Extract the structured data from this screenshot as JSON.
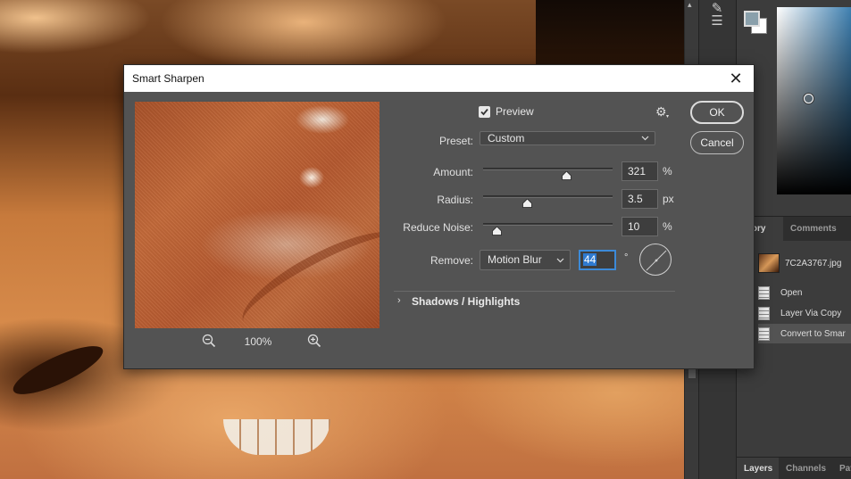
{
  "dialog": {
    "title": "Smart Sharpen",
    "preview_label": "Preview",
    "preview_checked": true,
    "zoom_level": "100%",
    "preset": {
      "label": "Preset:",
      "value": "Custom"
    },
    "amount": {
      "label": "Amount:",
      "value": "321",
      "unit": "%",
      "slider_fraction": 0.64
    },
    "radius": {
      "label": "Radius:",
      "value": "3.5",
      "unit": "px",
      "slider_fraction": 0.34
    },
    "reduce_noise": {
      "label": "Reduce Noise:",
      "value": "10",
      "unit": "%",
      "slider_fraction": 0.1
    },
    "remove": {
      "label": "Remove:",
      "value": "Motion Blur",
      "angle": "44",
      "angle_unit": "°"
    },
    "shadows_highlights": "Shadows / Highlights",
    "ok_label": "OK",
    "cancel_label": "Cancel"
  },
  "panels": {
    "history_tab": "story",
    "comments_tab": "Comments",
    "snapshot_name": "7C2A3767.jpg",
    "history_items": [
      "Open",
      "Layer Via Copy",
      "Convert to Smar"
    ],
    "bottom_tabs": [
      "Layers",
      "Channels",
      "Pat"
    ]
  },
  "colors": {
    "accent": "#3c8ad8",
    "dialog_bg": "#535353",
    "foreground_swatch": "#8aa0ab",
    "background_swatch": "#ffffff"
  },
  "icons": [
    "close-icon",
    "checkbox-check-icon",
    "gear-icon",
    "chevron-down-icon",
    "zoom-out-icon",
    "zoom-in-icon",
    "slider-knob-icon",
    "angle-dial-icon",
    "disclosure-chevron-icon",
    "document-icon"
  ]
}
